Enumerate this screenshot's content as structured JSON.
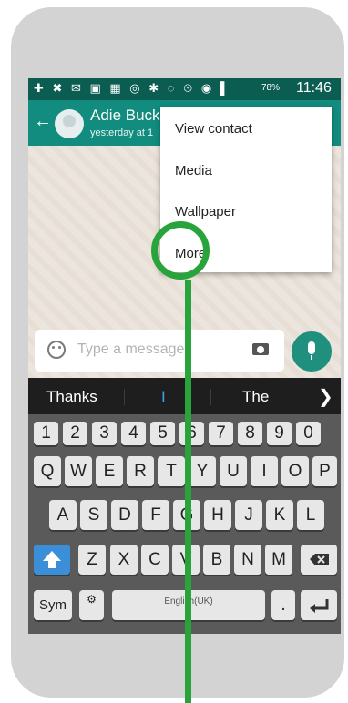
{
  "status_bar": {
    "battery": "78%",
    "time": "11:46"
  },
  "contact": {
    "name": "Adie Buck",
    "last_seen": "yesterday at 1"
  },
  "menu": {
    "items": [
      "View contact",
      "Media",
      "Wallpaper",
      "More"
    ]
  },
  "composer": {
    "placeholder": "Type a message"
  },
  "suggestions": [
    "Thanks",
    "I",
    "The"
  ],
  "keyboard": {
    "row1": [
      "1",
      "2",
      "3",
      "4",
      "5",
      "6",
      "7",
      "8",
      "9",
      "0"
    ],
    "row2": [
      "Q",
      "W",
      "E",
      "R",
      "T",
      "Y",
      "U",
      "I",
      "O",
      "P"
    ],
    "row3": [
      "A",
      "S",
      "D",
      "F",
      "G",
      "H",
      "J",
      "K",
      "L"
    ],
    "row4": [
      "Z",
      "X",
      "C",
      "V",
      "B",
      "N",
      "M"
    ],
    "sym_label": "Sym",
    "space_label": "English(UK)",
    "period": "."
  },
  "colors": {
    "header": "#128c7e",
    "status": "#0b5d52",
    "highlight": "#29a33b"
  }
}
